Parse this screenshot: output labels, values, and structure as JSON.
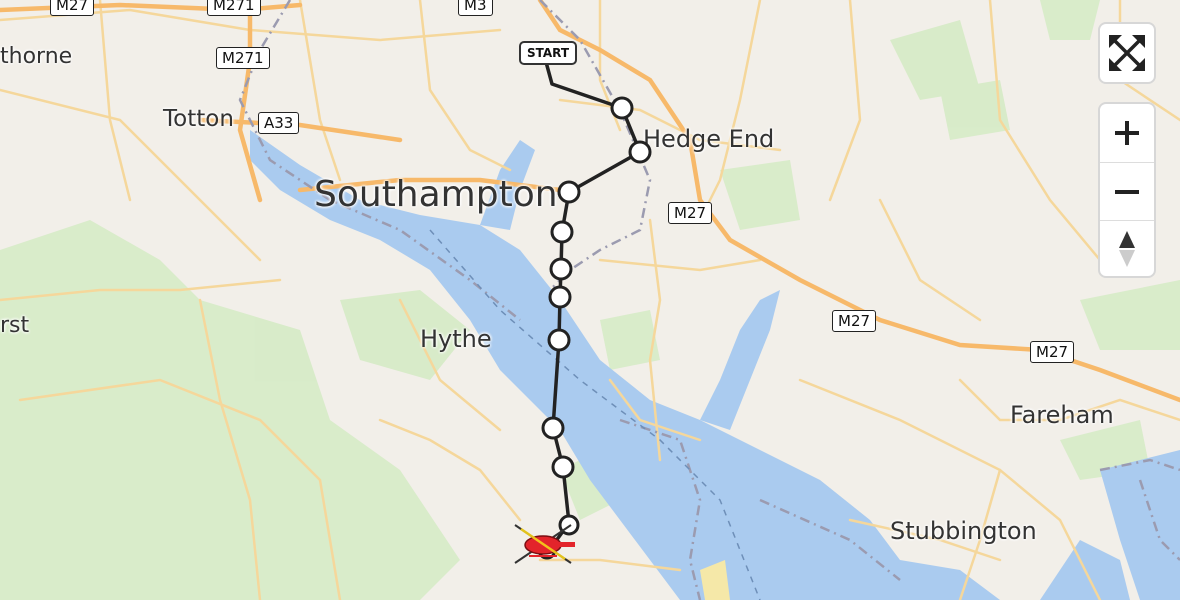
{
  "map": {
    "places": [
      {
        "id": "hawthorne",
        "label": "thorne"
      },
      {
        "id": "totton",
        "label": "Totton"
      },
      {
        "id": "southampton",
        "label": "Southampton"
      },
      {
        "id": "hedge-end",
        "label": "Hedge End"
      },
      {
        "id": "hythe",
        "label": "Hythe"
      },
      {
        "id": "fareham",
        "label": "Fareham"
      },
      {
        "id": "stubbington",
        "label": "Stubbington"
      },
      {
        "id": "lyndhurst",
        "label": "rst"
      }
    ],
    "road_shields": [
      {
        "id": "m27-nw",
        "label": "M27"
      },
      {
        "id": "m271-top",
        "label": "M271"
      },
      {
        "id": "m3-top",
        "label": "M3"
      },
      {
        "id": "m271-mid",
        "label": "M271"
      },
      {
        "id": "a33",
        "label": "A33"
      },
      {
        "id": "m27-center",
        "label": "M27"
      },
      {
        "id": "m27-east",
        "label": "M27"
      },
      {
        "id": "m27-far-east",
        "label": "M27"
      }
    ],
    "colors": {
      "land": "#f2efe9",
      "water": "#aacbef",
      "forest": "#cfe6bf",
      "motorway": "#f7b96a",
      "road": "#f5d79b",
      "route": "#222222",
      "waypoint_fill": "#ffffff",
      "destination_icon": "#e3242b"
    }
  },
  "route": {
    "start_label": "START",
    "waypoint_count": 11,
    "destination_icon": "helicopter-icon"
  },
  "controls": {
    "fullscreen_icon": "fullscreen-icon",
    "zoom_in_icon": "plus-icon",
    "zoom_out_icon": "minus-icon",
    "compass_icon": "compass-icon"
  }
}
